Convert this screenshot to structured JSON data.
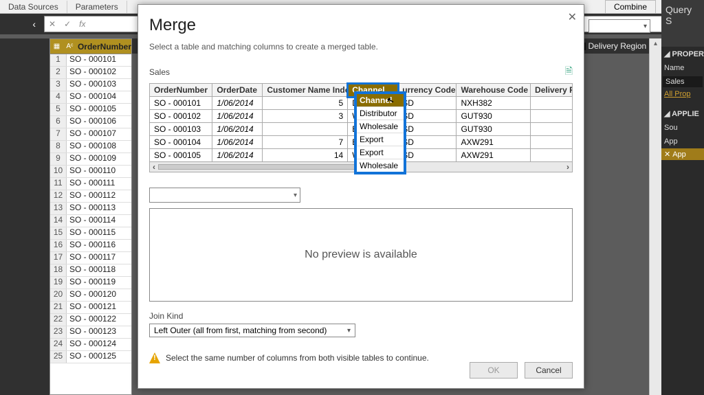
{
  "ribbon": {
    "tab1": "Data Sources",
    "tab2": "Parameters",
    "combine": "Combine"
  },
  "right_panel": {
    "title": "Query S",
    "prop_section": "PROPER",
    "name_label": "Name",
    "name_value": "Sales",
    "all_props": "All Prop",
    "applied_section": "APPLIE",
    "step1": "Sou",
    "step2": "App",
    "step3": "App"
  },
  "delivery_header": {
    "icon": "1₂₃",
    "label": "Delivery Region"
  },
  "left_column": {
    "header": "OrderNumber",
    "rows": [
      "SO - 000101",
      "SO - 000102",
      "SO - 000103",
      "SO - 000104",
      "SO - 000105",
      "SO - 000106",
      "SO - 000107",
      "SO - 000108",
      "SO - 000109",
      "SO - 000110",
      "SO - 000111",
      "SO - 000112",
      "SO - 000113",
      "SO - 000114",
      "SO - 000115",
      "SO - 000116",
      "SO - 000117",
      "SO - 000118",
      "SO - 000119",
      "SO - 000120",
      "SO - 000121",
      "SO - 000122",
      "SO - 000123",
      "SO - 000124",
      "SO - 000125"
    ]
  },
  "modal": {
    "title": "Merge",
    "subtitle": "Select a table and matching columns to create a merged table.",
    "table_label": "Sales",
    "columns": {
      "c1": "OrderNumber",
      "c2": "OrderDate",
      "c3": "Customer Name Index",
      "c4": "Channel",
      "c5": "urrency Code",
      "c6": "Warehouse Code",
      "c7": "Delivery R"
    },
    "rows": [
      {
        "on": "SO - 000101",
        "od": "1/06/2014",
        "cni": "5",
        "ch": "Distributor",
        "cc": "SD",
        "wc": "NXH382"
      },
      {
        "on": "SO - 000102",
        "od": "1/06/2014",
        "cni": "3",
        "ch": "Wholesale",
        "cc": "SD",
        "wc": "GUT930"
      },
      {
        "on": "SO - 000103",
        "od": "1/06/2014",
        "cni": "",
        "ch": "Export",
        "cc": "SD",
        "wc": "GUT930"
      },
      {
        "on": "SO - 000104",
        "od": "1/06/2014",
        "cni": "7",
        "ch": "Export",
        "cc": "SD",
        "wc": "AXW291"
      },
      {
        "on": "SO - 000105",
        "od": "1/06/2014",
        "cni": "14",
        "ch": "Wholesale",
        "cc": "SD",
        "wc": "AXW291"
      }
    ],
    "preview_msg": "No preview is available",
    "join_label": "Join Kind",
    "join_value": "Left Outer (all from first, matching from second)",
    "warning": "Select the same number of columns from both visible tables to continue.",
    "ok": "OK",
    "cancel": "Cancel"
  },
  "overlay": {
    "header": "Channel",
    "options": [
      "Distributor",
      "Wholesale",
      "Export",
      "Export",
      "Wholesale"
    ]
  },
  "fx": {
    "x": "✕",
    "check": "✓",
    "fx": "fx"
  }
}
